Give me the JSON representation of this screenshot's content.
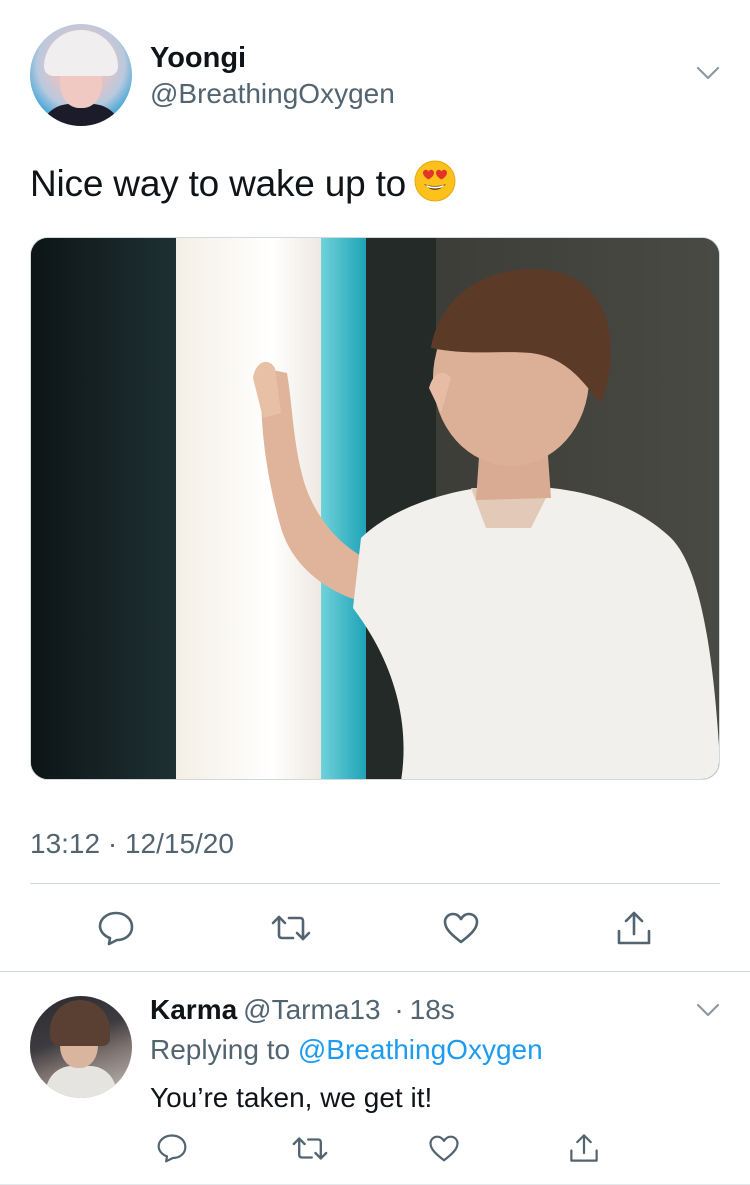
{
  "main_tweet": {
    "display_name": "Yoongi",
    "handle": "@BreathingOxygen",
    "text": "Nice way to wake up to",
    "emoji": "smiling-face-with-heart-eyes",
    "timestamp": "13:12 · 12/15/20"
  },
  "reply": {
    "display_name": "Karma",
    "handle": "@Tarma13",
    "separator": "·",
    "time_ago": "18s",
    "replying_prefix": "Replying to",
    "replying_to": "@BreathingOxygen",
    "text": "You’re taken, we get it!"
  },
  "icons": [
    "chevron-down-icon",
    "reply-icon",
    "retweet-icon",
    "like-icon",
    "share-icon"
  ],
  "colors": {
    "text": "#0f1419",
    "secondary": "#536471",
    "link": "#1d9bf0",
    "divider": "#cfd9de"
  }
}
